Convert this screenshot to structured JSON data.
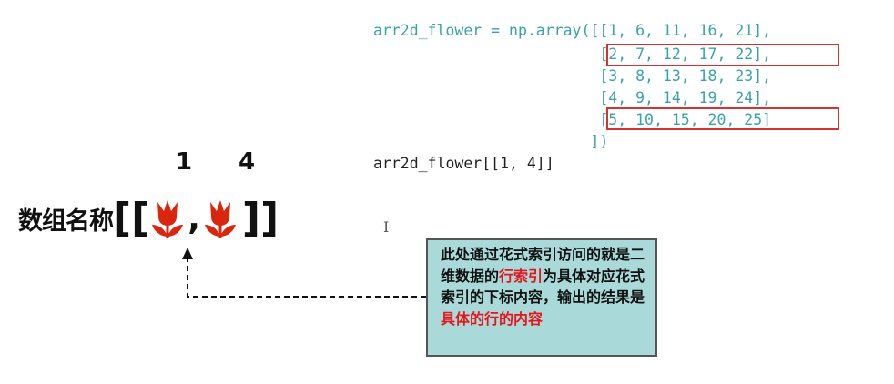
{
  "code": {
    "lines": [
      "arr2d_flower = np.array([[1, 6, 11, 16, 21],",
      "                         [2, 7, 12, 17, 22],",
      "                         [3, 8, 13, 18, 23],",
      "                         [4, 9, 14, 19, 24],",
      "                         [5, 10, 15, 20, 25]",
      "                        ])",
      "arr2d_flower[[1, 4]]"
    ]
  },
  "diagram": {
    "index_labels": [
      "1",
      "4"
    ],
    "array_name": "数组名称",
    "open_brackets": "[[",
    "comma": ",",
    "close_brackets": "]]",
    "flower_icon": "tulip-icon",
    "flower_color": "#d9260f"
  },
  "note": {
    "parts": [
      {
        "text": "此处通过花式索引访问的就是二维数据的",
        "highlight": false
      },
      {
        "text": "行索引",
        "highlight": true
      },
      {
        "text": "为具体对应花式索引的下标内容，输出的结果是",
        "highlight": false
      },
      {
        "text": "具体的行的内容",
        "highlight": true
      }
    ],
    "background": "#a9d9d9",
    "highlight_color": "#e8141b"
  },
  "colors": {
    "code": "#3aa3a8",
    "box": "#d9312b"
  }
}
